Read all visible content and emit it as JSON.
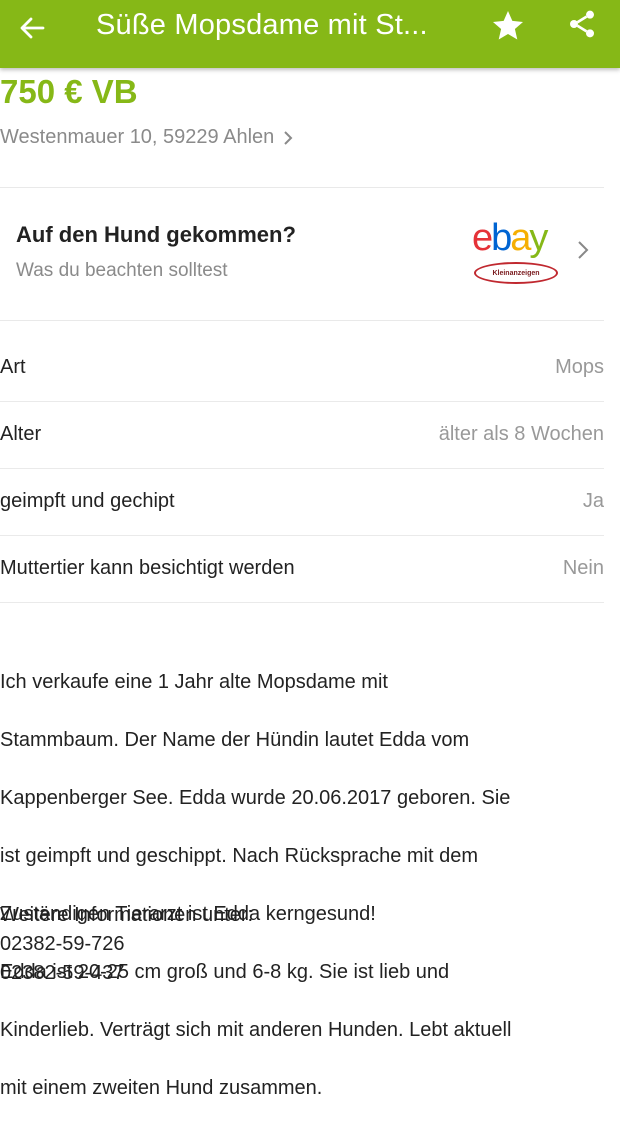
{
  "header": {
    "title": "Süße Mopsdame mit St...",
    "back_icon": "arrow-left-icon",
    "favorite_icon": "star-icon",
    "share_icon": "share-icon",
    "accent_color": "#86b817"
  },
  "listing": {
    "price": "750 € VB",
    "address": "Westenmauer 10, 59229 Ahlen"
  },
  "promo": {
    "title": "Auf den Hund gekommen?",
    "subtitle": "Was du beachten solltest",
    "logo_letters": [
      "e",
      "b",
      "a",
      "y"
    ],
    "logo_badge": "Kleinanzeigen"
  },
  "attributes": [
    {
      "label": "Art",
      "value": "Mops"
    },
    {
      "label": "Alter",
      "value": "älter als 8 Wochen"
    },
    {
      "label": "geimpft und gechipt",
      "value": "Ja"
    },
    {
      "label": "Muttertier kann besichtigt werden",
      "value": "Nein"
    }
  ],
  "description": {
    "lines": [
      "Ich verkaufe eine 1 Jahr alte Mopsdame mit",
      "Stammbaum. Der Name der Hündin lautet Edda vom",
      "Kappenberger See. Edda wurde 20.06.2017 geboren. Sie",
      "ist geimpft und geschippt. Nach Rücksprache mit dem",
      "Zuständigen Tierarzt ist Edda kerngesund!",
      "Edda ist 20-25 cm groß und 6-8 kg. Sie ist lieb und",
      "Kinderlieb. Verträgt sich mit anderen Hunden. Lebt aktuell",
      "mit einem zweiten Hund zusammen."
    ],
    "more_info_label": "Weitere Informationen unter:",
    "phones": [
      "02382-59-726",
      "02382-59-437"
    ]
  }
}
